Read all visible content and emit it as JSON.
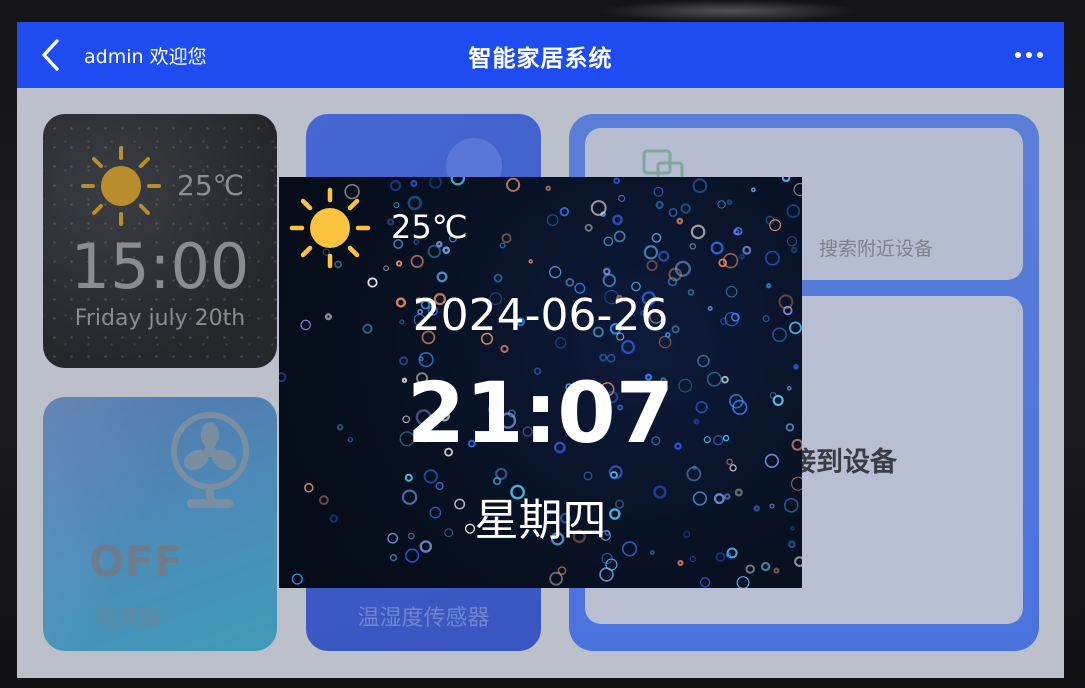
{
  "header": {
    "welcome": "admin 欢迎您",
    "title": "智能家居系统",
    "back_icon": "chevron-left-icon",
    "more_icon": "more-horizontal-icon"
  },
  "weather_card": {
    "temperature": "25℃",
    "time": "15:00",
    "date": "Friday july 20th",
    "icon": "sun-icon"
  },
  "fan_card": {
    "state": "OFF",
    "label": "电风扇",
    "icon": "fan-icon"
  },
  "sensor_card": {
    "label": "温湿度传感器",
    "icon": "lightning-icon"
  },
  "device_panel": {
    "search_label": "搜索附近设备",
    "connect_label": "接到设备",
    "search_icon": "device-search-icon"
  },
  "popup": {
    "temperature": "25℃",
    "date": "2024-06-26",
    "time": "21:07",
    "weekday": "星期四",
    "icon": "sun-icon"
  },
  "colors": {
    "header_bg": "#1f4cf0",
    "sun": "#fcc33e",
    "panel_blue": "#4a72dd"
  }
}
